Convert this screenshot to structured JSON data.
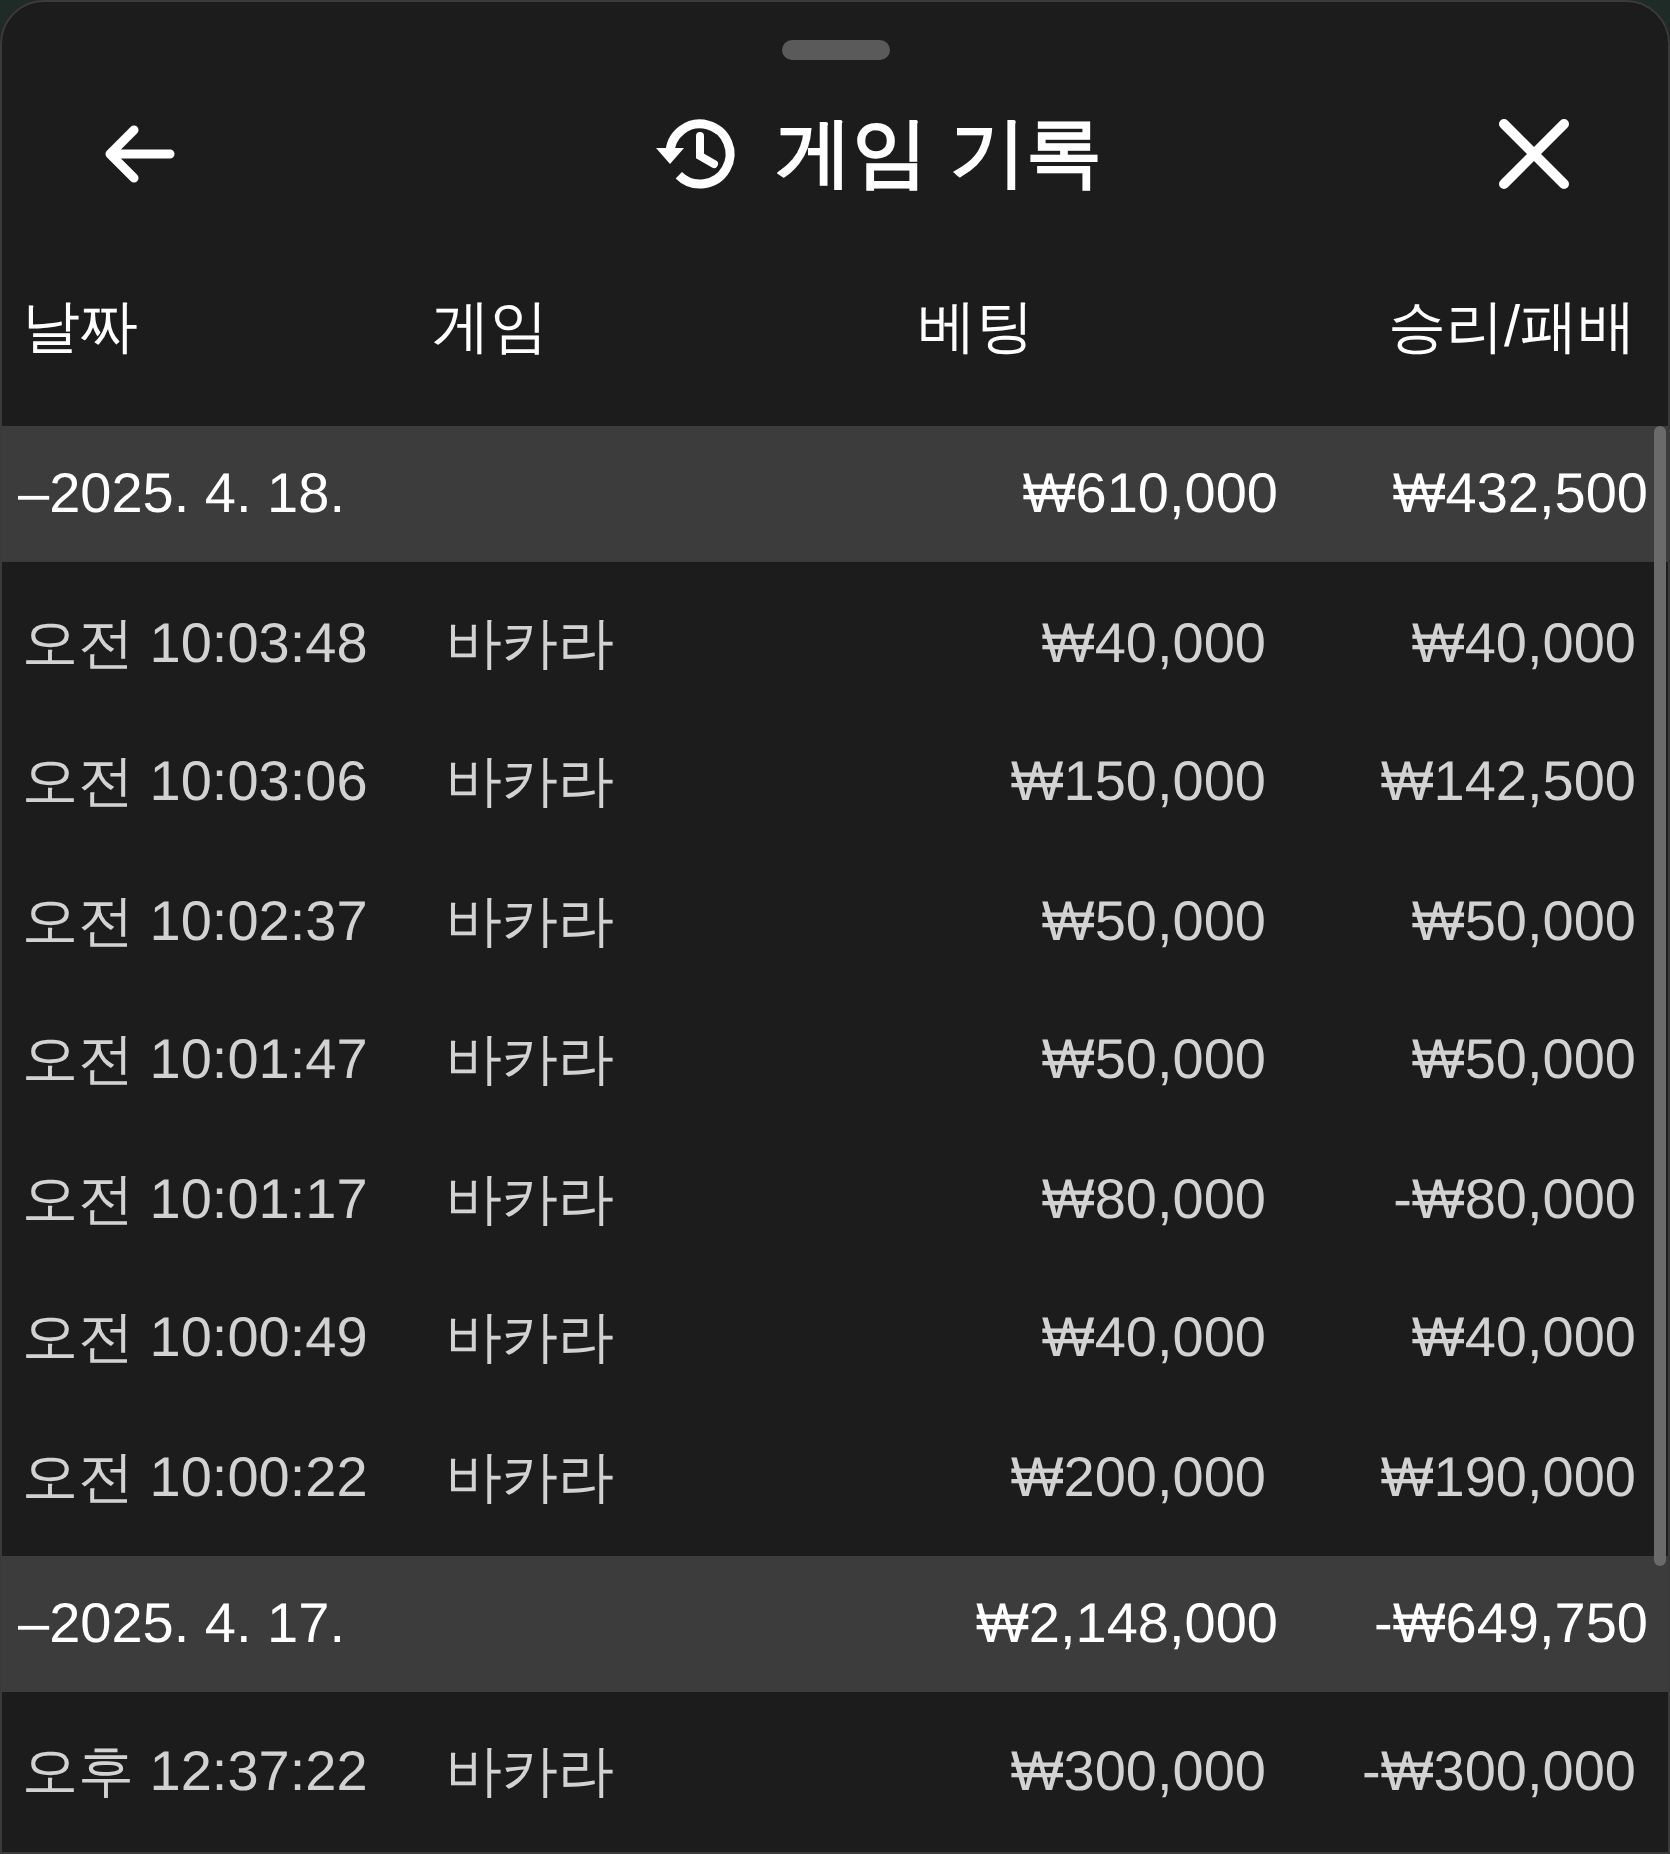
{
  "header": {
    "title": "게임 기록"
  },
  "table": {
    "columns": [
      "날짜",
      "게임",
      "베팅",
      "승리/패배"
    ],
    "groups": [
      {
        "date": "–2025. 4. 18.",
        "bet": "₩610,000",
        "result": "₩432,500",
        "rows": [
          {
            "time": "오전 10:03:48",
            "game": "바카라",
            "bet": "₩40,000",
            "result": "₩40,000"
          },
          {
            "time": "오전 10:03:06",
            "game": "바카라",
            "bet": "₩150,000",
            "result": "₩142,500"
          },
          {
            "time": "오전 10:02:37",
            "game": "바카라",
            "bet": "₩50,000",
            "result": "₩50,000"
          },
          {
            "time": "오전 10:01:47",
            "game": "바카라",
            "bet": "₩50,000",
            "result": "₩50,000"
          },
          {
            "time": "오전 10:01:17",
            "game": "바카라",
            "bet": "₩80,000",
            "result": "-₩80,000"
          },
          {
            "time": "오전 10:00:49",
            "game": "바카라",
            "bet": "₩40,000",
            "result": "₩40,000"
          },
          {
            "time": "오전 10:00:22",
            "game": "바카라",
            "bet": "₩200,000",
            "result": "₩190,000"
          }
        ]
      },
      {
        "date": "–2025. 4. 17.",
        "bet": "₩2,148,000",
        "result": "-₩649,750",
        "rows": [
          {
            "time": "오후 12:37:22",
            "game": "바카라",
            "bet": "₩300,000",
            "result": "-₩300,000"
          }
        ]
      }
    ]
  }
}
